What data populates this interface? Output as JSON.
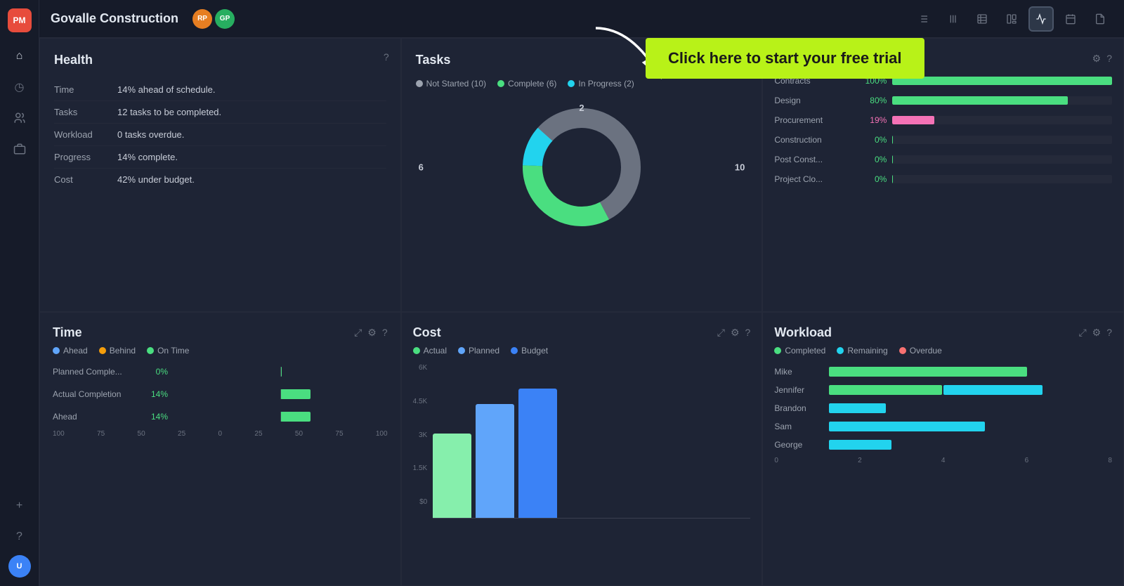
{
  "app": {
    "logo": "PM",
    "title": "Govalle Construction",
    "avatar1_initials": "RP",
    "avatar2_initials": "GP"
  },
  "toolbar": {
    "buttons": [
      {
        "id": "list",
        "icon": "≡",
        "label": "list-view"
      },
      {
        "id": "gantt",
        "icon": "|||",
        "label": "gantt-view"
      },
      {
        "id": "table2",
        "icon": "⊟",
        "label": "table2-view"
      },
      {
        "id": "board",
        "icon": "⊞",
        "label": "board-view"
      },
      {
        "id": "chart",
        "icon": "√",
        "label": "chart-view",
        "active": true
      },
      {
        "id": "calendar",
        "icon": "▦",
        "label": "calendar-view"
      },
      {
        "id": "doc",
        "icon": "📄",
        "label": "doc-view"
      }
    ]
  },
  "sidebar": {
    "items": [
      {
        "id": "home",
        "icon": "⌂"
      },
      {
        "id": "clock",
        "icon": "◷"
      },
      {
        "id": "users",
        "icon": "👥"
      },
      {
        "id": "briefcase",
        "icon": "💼"
      }
    ]
  },
  "banner": {
    "text": "Click here to start your free trial"
  },
  "health": {
    "title": "Health",
    "rows": [
      {
        "label": "Time",
        "value": "14% ahead of schedule."
      },
      {
        "label": "Tasks",
        "value": "12 tasks to be completed."
      },
      {
        "label": "Workload",
        "value": "0 tasks overdue."
      },
      {
        "label": "Progress",
        "value": "14% complete."
      },
      {
        "label": "Cost",
        "value": "42% under budget."
      }
    ]
  },
  "tasks": {
    "title": "Tasks",
    "legend": [
      {
        "label": "Not Started (10)",
        "color": "#9ca3af"
      },
      {
        "label": "Complete (6)",
        "color": "#4ade80"
      },
      {
        "label": "In Progress (2)",
        "color": "#22d3ee"
      }
    ],
    "donut": {
      "not_started": 10,
      "complete": 6,
      "in_progress": 2,
      "label_left": "6",
      "label_right": "10",
      "label_top": "2"
    },
    "progress_bars": [
      {
        "label": "Contracts",
        "pct": 100,
        "color": "#4ade80",
        "pct_text": "100%"
      },
      {
        "label": "Design",
        "pct": 80,
        "color": "#4ade80",
        "pct_text": "80%"
      },
      {
        "label": "Procurement",
        "pct": 19,
        "color": "#f472b6",
        "pct_text": "19%"
      },
      {
        "label": "Construction",
        "pct": 0,
        "color": "#4ade80",
        "pct_text": "0%"
      },
      {
        "label": "Post Const...",
        "pct": 0,
        "color": "#4ade80",
        "pct_text": "0%"
      },
      {
        "label": "Project Clo...",
        "pct": 0,
        "color": "#4ade80",
        "pct_text": "0%"
      }
    ]
  },
  "time": {
    "title": "Time",
    "legend": [
      {
        "label": "Ahead",
        "color": "#60a5fa"
      },
      {
        "label": "Behind",
        "color": "#f59e0b"
      },
      {
        "label": "On Time",
        "color": "#4ade80"
      }
    ],
    "rows": [
      {
        "label": "Planned Comple...",
        "pct_text": "0%",
        "value": 0
      },
      {
        "label": "Actual Completion",
        "pct_text": "14%",
        "value": 14
      },
      {
        "label": "Ahead",
        "pct_text": "14%",
        "value": 14
      }
    ],
    "x_axis": [
      "100",
      "75",
      "50",
      "25",
      "0",
      "25",
      "50",
      "75",
      "100"
    ]
  },
  "cost": {
    "title": "Cost",
    "legend": [
      {
        "label": "Actual",
        "color": "#4ade80"
      },
      {
        "label": "Planned",
        "color": "#60a5fa"
      },
      {
        "label": "Budget",
        "color": "#3b82f6"
      }
    ],
    "y_axis": [
      "6K",
      "4.5K",
      "3K",
      "1.5K",
      "$0"
    ],
    "bars": [
      {
        "actual": 60,
        "planned": 90,
        "budget": 100
      }
    ]
  },
  "workload": {
    "title": "Workload",
    "legend": [
      {
        "label": "Completed",
        "color": "#4ade80"
      },
      {
        "label": "Remaining",
        "color": "#22d3ee"
      },
      {
        "label": "Overdue",
        "color": "#f87171"
      }
    ],
    "rows": [
      {
        "name": "Mike",
        "completed": 70,
        "remaining": 0,
        "overdue": 0
      },
      {
        "name": "Jennifer",
        "completed": 40,
        "remaining": 35,
        "overdue": 0
      },
      {
        "name": "Brandon",
        "completed": 0,
        "remaining": 20,
        "overdue": 0
      },
      {
        "name": "Sam",
        "completed": 0,
        "remaining": 55,
        "overdue": 0
      },
      {
        "name": "George",
        "completed": 0,
        "remaining": 22,
        "overdue": 0
      }
    ],
    "x_axis": [
      "0",
      "2",
      "4",
      "6",
      "8"
    ]
  }
}
